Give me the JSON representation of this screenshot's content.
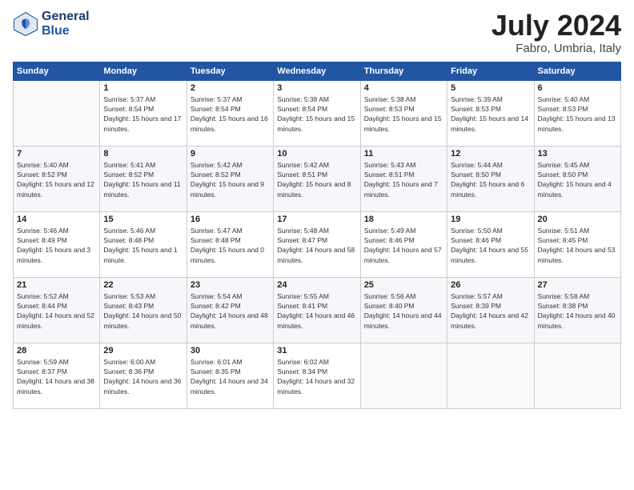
{
  "header": {
    "logo_line1": "General",
    "logo_line2": "Blue",
    "month": "July 2024",
    "location": "Fabro, Umbria, Italy"
  },
  "days_of_week": [
    "Sunday",
    "Monday",
    "Tuesday",
    "Wednesday",
    "Thursday",
    "Friday",
    "Saturday"
  ],
  "weeks": [
    [
      {
        "num": "",
        "empty": true
      },
      {
        "num": "1",
        "rise": "5:37 AM",
        "set": "8:54 PM",
        "daylight": "15 hours and 17 minutes."
      },
      {
        "num": "2",
        "rise": "5:37 AM",
        "set": "8:54 PM",
        "daylight": "15 hours and 16 minutes."
      },
      {
        "num": "3",
        "rise": "5:38 AM",
        "set": "8:54 PM",
        "daylight": "15 hours and 15 minutes."
      },
      {
        "num": "4",
        "rise": "5:38 AM",
        "set": "8:53 PM",
        "daylight": "15 hours and 15 minutes."
      },
      {
        "num": "5",
        "rise": "5:39 AM",
        "set": "8:53 PM",
        "daylight": "15 hours and 14 minutes."
      },
      {
        "num": "6",
        "rise": "5:40 AM",
        "set": "8:53 PM",
        "daylight": "15 hours and 13 minutes."
      }
    ],
    [
      {
        "num": "7",
        "rise": "5:40 AM",
        "set": "8:52 PM",
        "daylight": "15 hours and 12 minutes."
      },
      {
        "num": "8",
        "rise": "5:41 AM",
        "set": "8:52 PM",
        "daylight": "15 hours and 11 minutes."
      },
      {
        "num": "9",
        "rise": "5:42 AM",
        "set": "8:52 PM",
        "daylight": "15 hours and 9 minutes."
      },
      {
        "num": "10",
        "rise": "5:42 AM",
        "set": "8:51 PM",
        "daylight": "15 hours and 8 minutes."
      },
      {
        "num": "11",
        "rise": "5:43 AM",
        "set": "8:51 PM",
        "daylight": "15 hours and 7 minutes."
      },
      {
        "num": "12",
        "rise": "5:44 AM",
        "set": "8:50 PM",
        "daylight": "15 hours and 6 minutes."
      },
      {
        "num": "13",
        "rise": "5:45 AM",
        "set": "8:50 PM",
        "daylight": "15 hours and 4 minutes."
      }
    ],
    [
      {
        "num": "14",
        "rise": "5:46 AM",
        "set": "8:49 PM",
        "daylight": "15 hours and 3 minutes."
      },
      {
        "num": "15",
        "rise": "5:46 AM",
        "set": "8:48 PM",
        "daylight": "15 hours and 1 minute."
      },
      {
        "num": "16",
        "rise": "5:47 AM",
        "set": "8:48 PM",
        "daylight": "15 hours and 0 minutes."
      },
      {
        "num": "17",
        "rise": "5:48 AM",
        "set": "8:47 PM",
        "daylight": "14 hours and 58 minutes."
      },
      {
        "num": "18",
        "rise": "5:49 AM",
        "set": "8:46 PM",
        "daylight": "14 hours and 57 minutes."
      },
      {
        "num": "19",
        "rise": "5:50 AM",
        "set": "8:46 PM",
        "daylight": "14 hours and 55 minutes."
      },
      {
        "num": "20",
        "rise": "5:51 AM",
        "set": "8:45 PM",
        "daylight": "14 hours and 53 minutes."
      }
    ],
    [
      {
        "num": "21",
        "rise": "5:52 AM",
        "set": "8:44 PM",
        "daylight": "14 hours and 52 minutes."
      },
      {
        "num": "22",
        "rise": "5:53 AM",
        "set": "8:43 PM",
        "daylight": "14 hours and 50 minutes."
      },
      {
        "num": "23",
        "rise": "5:54 AM",
        "set": "8:42 PM",
        "daylight": "14 hours and 48 minutes."
      },
      {
        "num": "24",
        "rise": "5:55 AM",
        "set": "8:41 PM",
        "daylight": "14 hours and 46 minutes."
      },
      {
        "num": "25",
        "rise": "5:56 AM",
        "set": "8:40 PM",
        "daylight": "14 hours and 44 minutes."
      },
      {
        "num": "26",
        "rise": "5:57 AM",
        "set": "8:39 PM",
        "daylight": "14 hours and 42 minutes."
      },
      {
        "num": "27",
        "rise": "5:58 AM",
        "set": "8:38 PM",
        "daylight": "14 hours and 40 minutes."
      }
    ],
    [
      {
        "num": "28",
        "rise": "5:59 AM",
        "set": "8:37 PM",
        "daylight": "14 hours and 38 minutes."
      },
      {
        "num": "29",
        "rise": "6:00 AM",
        "set": "8:36 PM",
        "daylight": "14 hours and 36 minutes."
      },
      {
        "num": "30",
        "rise": "6:01 AM",
        "set": "8:35 PM",
        "daylight": "14 hours and 34 minutes."
      },
      {
        "num": "31",
        "rise": "6:02 AM",
        "set": "8:34 PM",
        "daylight": "14 hours and 32 minutes."
      },
      {
        "num": "",
        "empty": true
      },
      {
        "num": "",
        "empty": true
      },
      {
        "num": "",
        "empty": true
      }
    ]
  ]
}
